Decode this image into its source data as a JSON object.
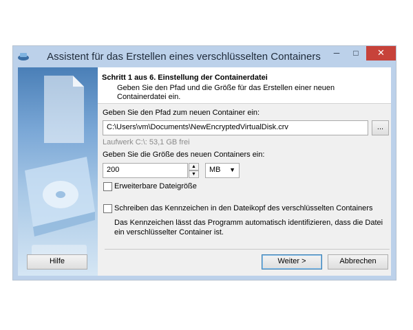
{
  "window": {
    "title": "Assistent für das Erstellen eines verschlüsselten Containers",
    "minimize_glyph": "─",
    "maximize_glyph": "□",
    "close_glyph": "✕"
  },
  "header": {
    "step_title": "Schritt 1 aus 6. Einstellung der Containerdatei",
    "step_description": "Geben Sie den Pfad und die Größe für das Erstellen einer neuen Containerdatei ein."
  },
  "path": {
    "label": "Geben Sie den Pfad zum neuen Container ein:",
    "value": "C:\\Users\\vm\\Documents\\NewEncryptedVirtualDisk.crv",
    "browse_label": "...",
    "drive_info": "Laufwerk C:\\: 53,1 GB frei"
  },
  "size": {
    "label": "Geben Sie die Größe des neuen Containers ein:",
    "value": "200",
    "unit": "MB",
    "expandable_label": "Erweiterbare Dateigröße"
  },
  "signature": {
    "checkbox_label": "Schreiben das Kennzeichen in den Dateikopf des verschlüsselten Containers",
    "description": "Das Kennzeichen lässt das Programm automatisch identifizieren, dass die Datei ein verschlüsselter Container ist."
  },
  "buttons": {
    "help": "Hilfe",
    "next": "Weiter >",
    "cancel": "Abbrechen"
  }
}
